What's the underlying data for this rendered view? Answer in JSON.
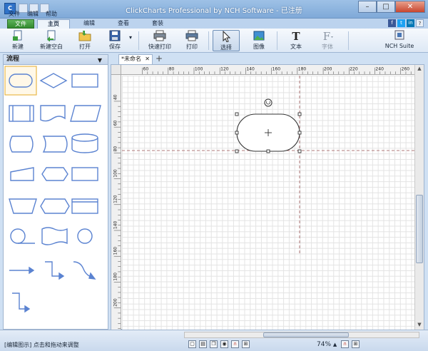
{
  "window": {
    "title": "ClickCharts Professional by NCH Software - 已注册",
    "app_icon": "app-icon",
    "minimize": "–",
    "maximize": "□",
    "close": "✕"
  },
  "menu": [
    "文件",
    "编辑",
    "帮助"
  ],
  "tabs": {
    "file": "文件",
    "home": "主页",
    "edit": "编辑",
    "view": "查看",
    "suite": "套装"
  },
  "social": [
    "f",
    "t",
    "in"
  ],
  "ribbon": {
    "new": "新建",
    "new_blank": "新建空白",
    "open": "打开",
    "save": "保存",
    "quick_print": "快速打印",
    "print": "打印",
    "select": "选择",
    "image": "图像",
    "text": "文本",
    "font": "字体",
    "nch_suite": "NCH Suite"
  },
  "panel": {
    "title": "流程",
    "dropdown": "▼"
  },
  "document": {
    "tab_label": "*未命名",
    "tab_close": "✕",
    "add_tab": "+"
  },
  "rulers": {
    "top": [
      "60",
      "80",
      "100",
      "120",
      "140",
      "160",
      "180",
      "200",
      "220",
      "240",
      "260"
    ],
    "left": [
      "40",
      "60",
      "80",
      "100",
      "120",
      "140",
      "160",
      "180",
      "200"
    ]
  },
  "status": {
    "hint": "[编辑图示] 点击和拖动来调整",
    "zoom": "74%",
    "zoom_arrow": "▲"
  },
  "colors": {
    "shape_stroke": "#5b83d1",
    "selection": "#e8b84a",
    "guide": "#b07a7a",
    "accent_green": "#318a2d"
  }
}
